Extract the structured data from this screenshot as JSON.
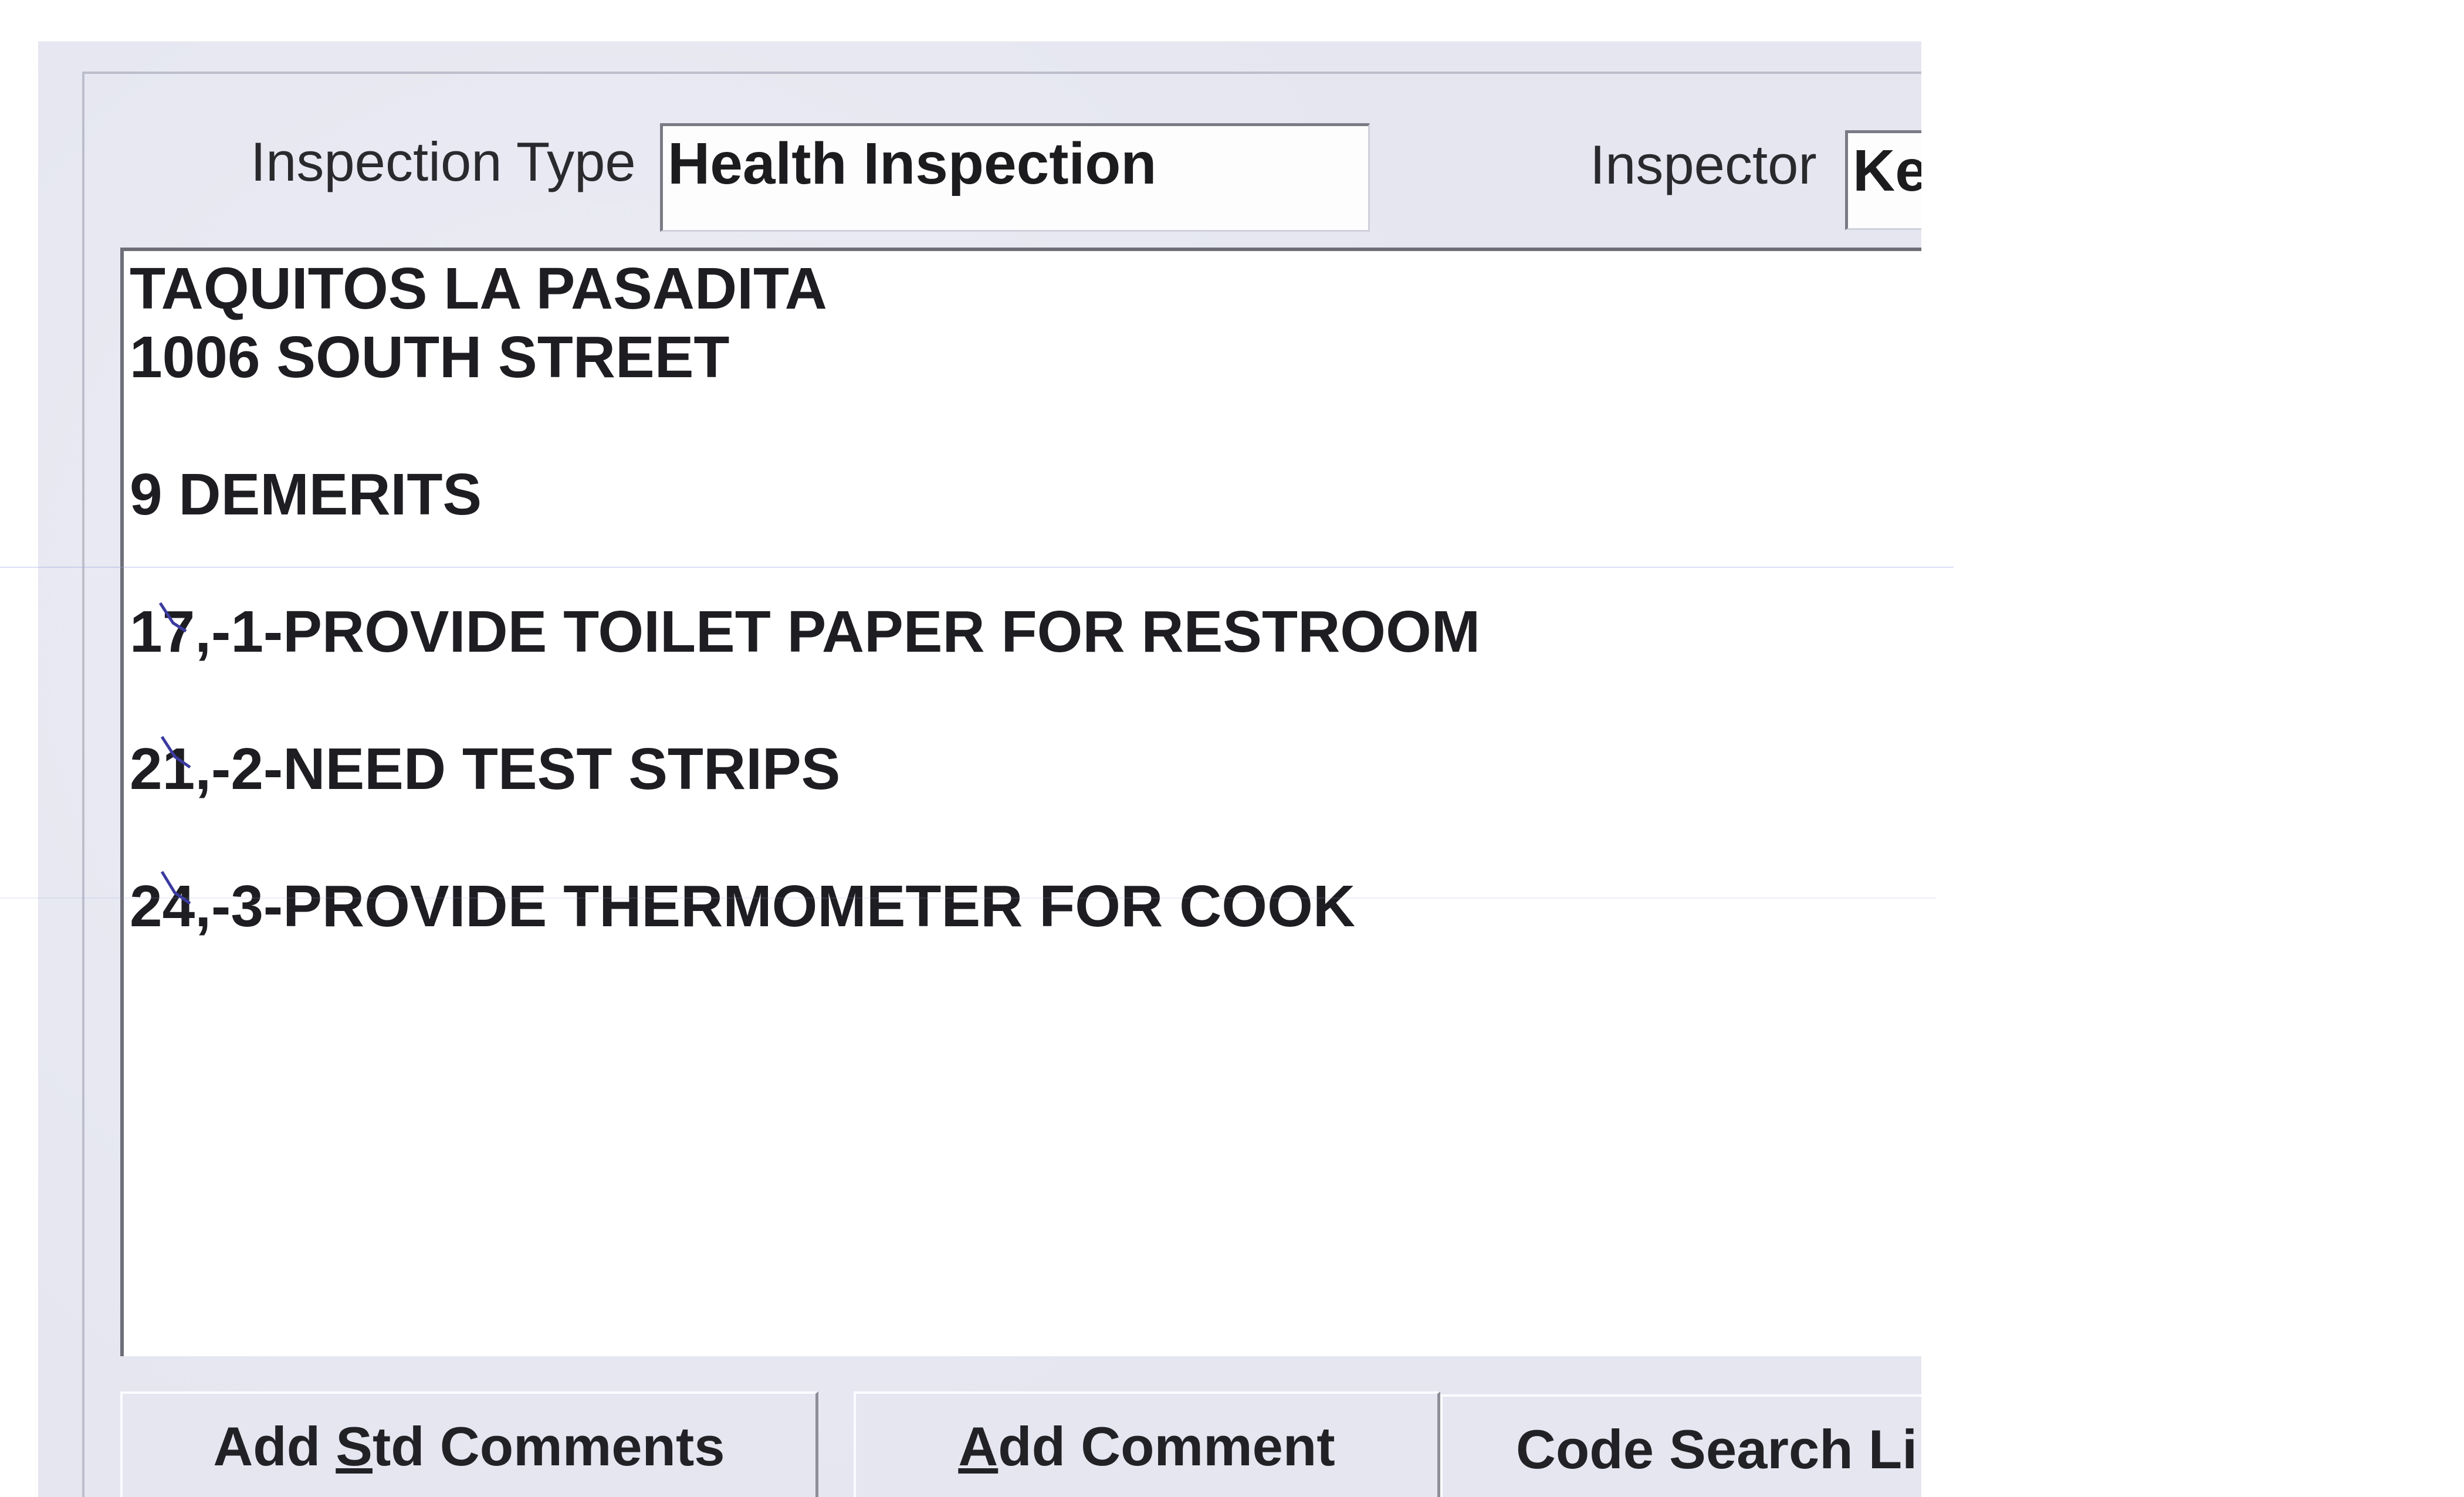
{
  "form": {
    "inspection_type_label": "Inspection Type",
    "inspection_type_value": "Health Inspection",
    "inspector_label": "Inspector",
    "inspector_value": "Ke"
  },
  "comments": {
    "lines": [
      "TAQUITOS LA PASADITA",
      "1006 SOUTH STREET",
      "",
      "9 DEMERITS",
      "",
      "17,-1-PROVIDE TOILET PAPER FOR RESTROOM",
      "",
      "21,-2-NEED TEST STRIPS",
      "",
      "24,-3-PROVIDE THERMOMETER FOR COOK"
    ]
  },
  "buttons": {
    "add_std_comments_pre": "Add ",
    "add_std_comments_mn": "S",
    "add_std_comments_post": "td Comments",
    "add_comment_mn": "A",
    "add_comment_post": "dd Comment",
    "code_search": "Code Search Li"
  },
  "colors": {
    "window_bg": "#e5e6f0",
    "field_bg": "#ffffff",
    "pen_mark": "#3a3aa0"
  }
}
